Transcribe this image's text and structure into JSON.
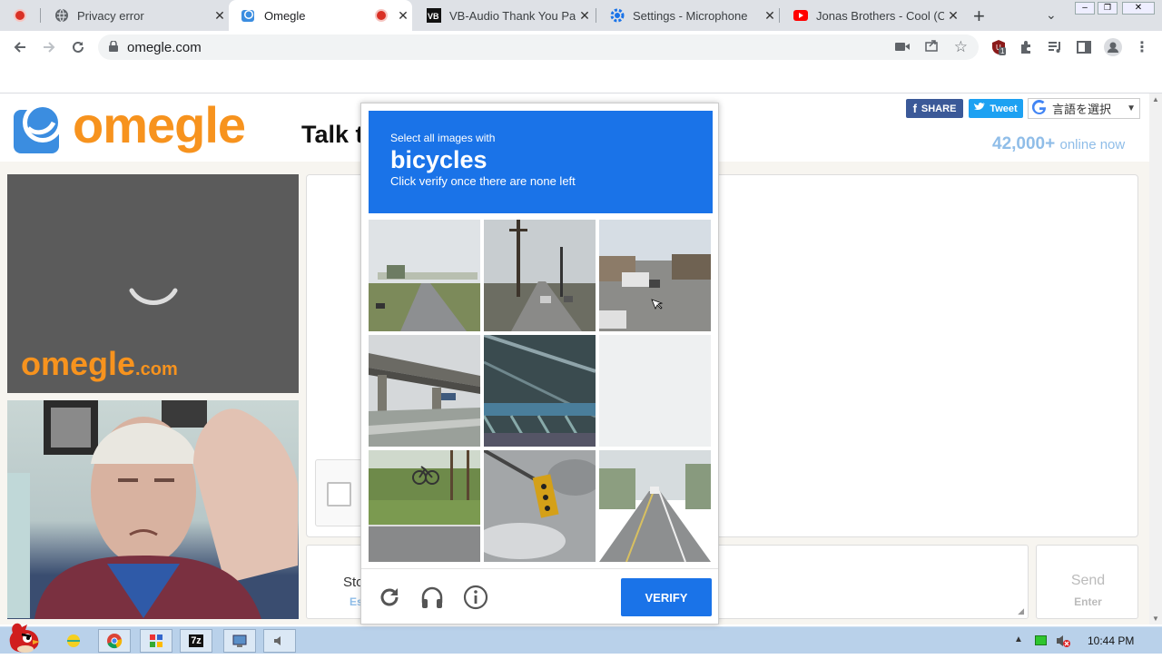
{
  "browser": {
    "tabs": [
      {
        "title": "Privacy error",
        "favicon": "globe-icon",
        "recording": true
      },
      {
        "title": "Omegle",
        "favicon": "omegle-icon",
        "recording": true,
        "active": true
      },
      {
        "title": "VB-Audio Thank You Pa",
        "favicon": "vb-audio-icon"
      },
      {
        "title": "Settings - Microphone",
        "favicon": "gear-icon"
      },
      {
        "title": "Jonas Brothers - Cool (C",
        "favicon": "youtube-icon"
      }
    ],
    "new_tab_symbol": "+",
    "url": "omegle.com",
    "extension_badge": "1"
  },
  "omegle": {
    "logo_text": "omegle",
    "tagline": "Talk t",
    "share_label": "SHARE",
    "tweet_label": "Tweet",
    "translate_label": "言語を選択",
    "online_count": "42,000+",
    "online_label": "online now",
    "video_logo": "omegle",
    "video_logo_suffix": ".com",
    "stop_label": "Sto",
    "esc_label": "Es",
    "send_label": "Send",
    "enter_label": "Enter"
  },
  "captcha": {
    "instruction": "Select all images with",
    "target": "bicycles",
    "sub_instruction": "Click verify once there are none left",
    "verify_label": "VERIFY",
    "tiles": [
      "road-with-overpass",
      "street-with-poles",
      "city-street-cars",
      "highway-underpass",
      "bridge-structure",
      "faded-blank",
      "bicycle-on-grass",
      "traffic-light",
      "rural-road"
    ]
  },
  "taskbar": {
    "clock": "10:44 PM",
    "seven_zip_label": "7z"
  },
  "colors": {
    "accent": "#1a73e8",
    "omegle_orange": "#f7931e",
    "omegle_blue": "#3b8de0"
  }
}
